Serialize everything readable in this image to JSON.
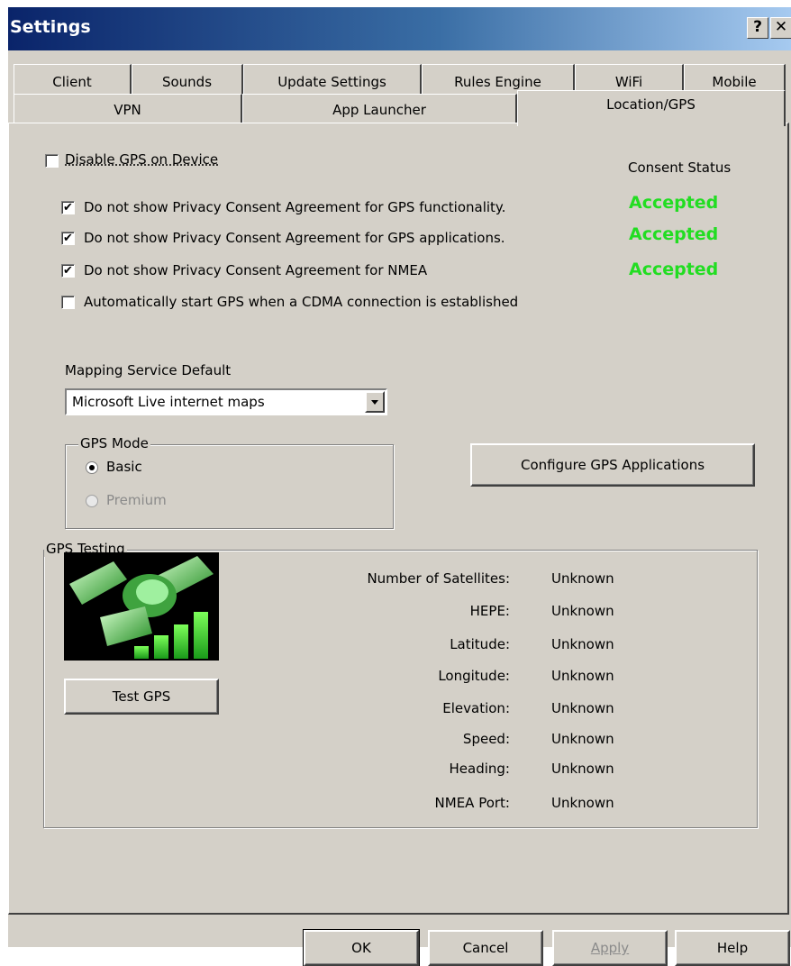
{
  "window": {
    "title": "Settings",
    "help_button": "?",
    "close_button": "✕"
  },
  "tabs": {
    "row1": [
      "Client",
      "Sounds",
      "Update Settings",
      "Rules Engine",
      "WiFi",
      "Mobile"
    ],
    "row2": [
      "VPN",
      "App Launcher",
      "Location/GPS"
    ],
    "active": "Location/GPS"
  },
  "location": {
    "disable_gps_label": "Disable GPS on Device",
    "disable_gps_checked": false,
    "consent_status_label": "Consent Status",
    "consent_options": [
      {
        "label": "Do not show Privacy Consent Agreement for GPS functionality.",
        "checked": true,
        "status": "Accepted"
      },
      {
        "label": "Do not show Privacy Consent Agreement for GPS applications.",
        "checked": true,
        "status": "Accepted"
      },
      {
        "label": "Do not show Privacy Consent Agreement for NMEA",
        "checked": true,
        "status": "Accepted"
      }
    ],
    "auto_start_label": "Automatically start GPS when a CDMA connection is established",
    "auto_start_checked": false,
    "status_color": "#22dd22",
    "mapping_label": "Mapping Service Default",
    "mapping_selected": "Microsoft Live internet maps",
    "gps_mode_legend": "GPS Mode",
    "gps_mode_basic": "Basic",
    "gps_mode_premium": "Premium",
    "gps_mode_selected": "Basic",
    "configure_button": "Configure GPS Applications"
  },
  "testing": {
    "legend": "GPS Testing",
    "image_icon": "satellite-signal-icon",
    "test_button": "Test GPS",
    "fields": [
      {
        "label": "Number of Satellites:",
        "value": "Unknown"
      },
      {
        "label": "HEPE:",
        "value": "Unknown"
      },
      {
        "label": "Latitude:",
        "value": "Unknown"
      },
      {
        "label": "Longitude:",
        "value": "Unknown"
      },
      {
        "label": "Elevation:",
        "value": "Unknown"
      },
      {
        "label": "Speed:",
        "value": "Unknown"
      },
      {
        "label": "Heading:",
        "value": "Unknown"
      },
      {
        "label": "NMEA Port:",
        "value": "Unknown"
      }
    ]
  },
  "footer": {
    "ok": "OK",
    "cancel": "Cancel",
    "apply": "Apply",
    "help": "Help"
  }
}
